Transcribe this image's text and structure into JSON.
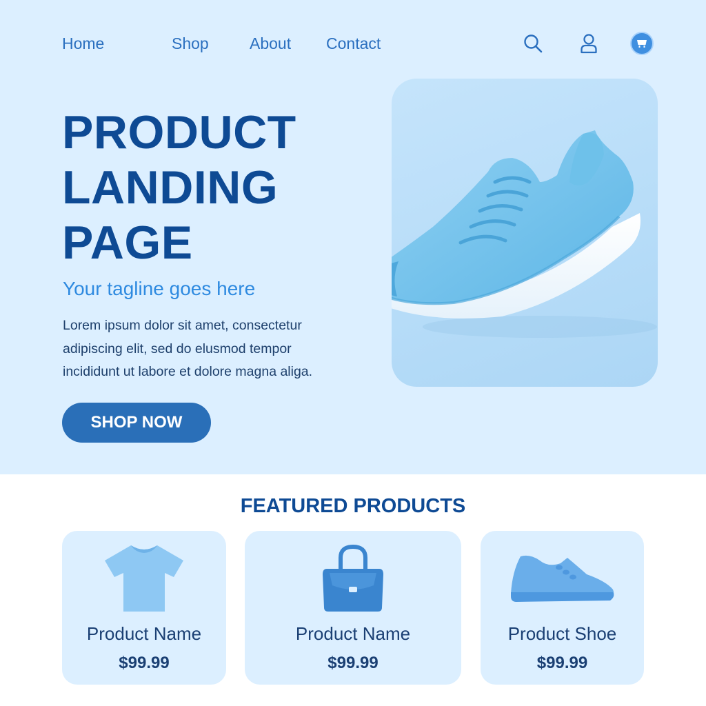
{
  "nav": {
    "links": [
      "Home",
      "Shop",
      "About",
      "Contact"
    ],
    "icons": [
      "search-icon",
      "user-icon",
      "cart-icon"
    ]
  },
  "hero": {
    "title_lines": [
      "PRODUCT",
      "LANDING",
      "PAGE"
    ],
    "tagline": "Your tagline goes here",
    "body_lines": [
      "Lorem ipsum dolor sit amet, consectetur",
      "adipiscing elit, sed do elusmod tempor",
      "incididunt ut labore et dolore magna aliga."
    ],
    "cta": "SHOP NOW",
    "image": "sneaker-image"
  },
  "featured": {
    "title": "FEATURED PRODUCTS",
    "products": [
      {
        "name": "Product Name",
        "price": "$99.99",
        "icon": "tshirt-icon"
      },
      {
        "name": "Product Name",
        "price": "$99.99",
        "icon": "handbag-icon"
      },
      {
        "name": "Product Shoe",
        "price": "$99.99",
        "icon": "shoe-icon"
      }
    ]
  },
  "colors": {
    "hero_bg": "#dcefff",
    "primary_dark": "#0e4a94",
    "accent": "#2e8ae0",
    "button": "#2a6fb8",
    "card_bg": "#dcefff"
  }
}
